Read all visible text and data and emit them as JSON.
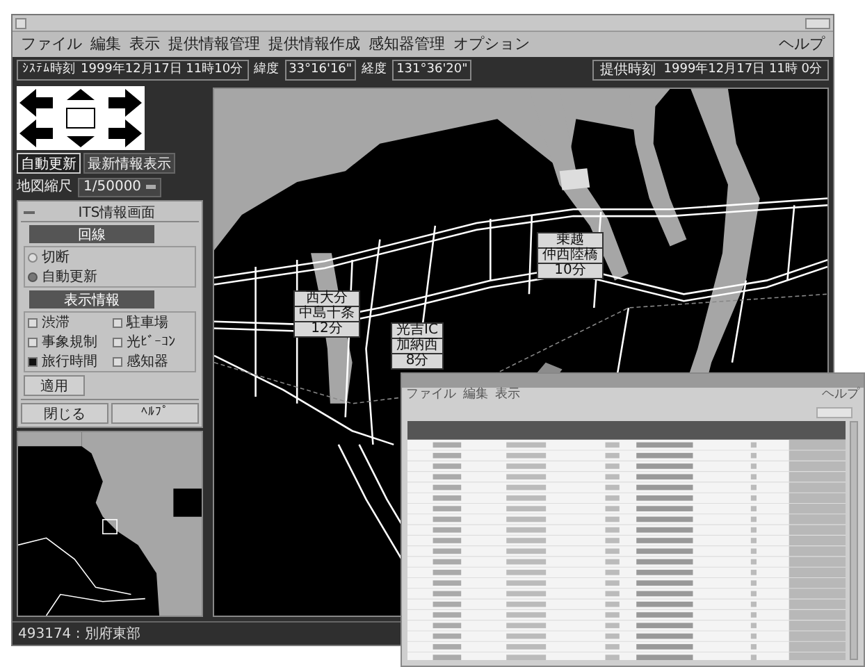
{
  "window": {
    "menu": [
      "ファイル",
      "編集",
      "表示",
      "提供情報管理",
      "提供情報作成",
      "感知器管理",
      "オプション"
    ],
    "help": "ヘルプ"
  },
  "toolbar": {
    "system_time_label": "ｼｽﾃﾑ時刻",
    "system_time": "1999年12月17日 11時10分",
    "lat_label": "緯度",
    "lat": "33°16'16\"",
    "lon_label": "経度",
    "lon": "131°36'20\"",
    "provide_time_label": "提供時刻",
    "provide_time": "1999年12月17日 11時 0分"
  },
  "left_panel": {
    "buttons": [
      {
        "label": "自動更新",
        "selected": true
      },
      {
        "label": "最新情報表示",
        "selected": false
      }
    ],
    "scale_label": "地図縮尺",
    "scale": "1/50000"
  },
  "its_dialog": {
    "title": "ITS情報画面",
    "line_heading": "回線",
    "radios": [
      {
        "label": "切断",
        "selected": false
      },
      {
        "label": "自動更新",
        "selected": true
      }
    ],
    "display_heading": "表示情報",
    "checks": [
      {
        "label": "渋滞",
        "checked": false
      },
      {
        "label": "駐車場",
        "checked": false
      },
      {
        "label": "事象規制",
        "checked": false
      },
      {
        "label": "光ﾋﾞｰｺﾝ",
        "checked": false
      },
      {
        "label": "旅行時間",
        "checked": true
      },
      {
        "label": "感知器",
        "checked": false
      }
    ],
    "apply": "適用",
    "close": "閉じる",
    "help": "ﾍﾙﾌﾟ"
  },
  "map_signs": [
    {
      "lines": [
        "西大分",
        "中島十条",
        "12分"
      ]
    },
    {
      "lines": [
        "光吉IC",
        "加納西",
        "8分"
      ]
    },
    {
      "lines": [
        "乗越",
        "仲西陸橋",
        "10分"
      ]
    }
  ],
  "status_bar": "493174 : 別府東部",
  "list_window": {
    "menu": [
      "ファイル",
      "編集",
      "表示"
    ],
    "help": "ヘルプ"
  }
}
